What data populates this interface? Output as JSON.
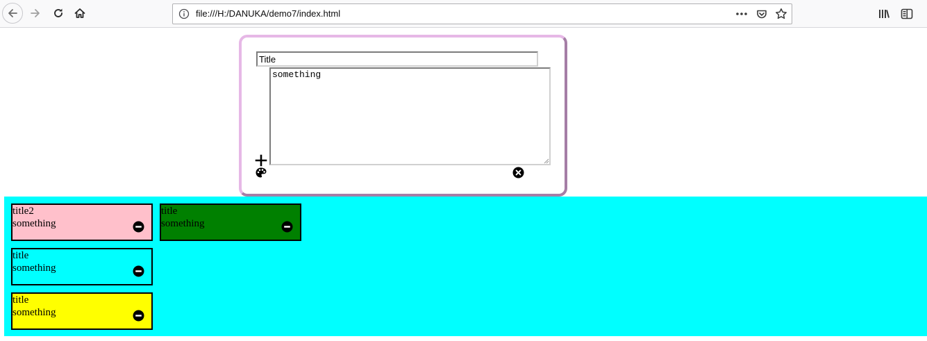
{
  "browser": {
    "url": "file:///H:/DANUKA/demo7/index.html"
  },
  "editor": {
    "title_value": "Title",
    "body_value": "something",
    "border_color": "#e6b8e6"
  },
  "board": {
    "background": "#00ffff",
    "notes": [
      {
        "title": "title2",
        "body": "something",
        "color": "#ffc0cb"
      },
      {
        "title": "title",
        "body": "something",
        "color": "#008000"
      },
      {
        "title": "title",
        "body": "something",
        "color": "#00ffff"
      },
      {
        "title": "title",
        "body": "something",
        "color": "#ffff00"
      }
    ]
  },
  "icons": {
    "back": "arrow-left-icon",
    "forward": "arrow-right-icon",
    "reload": "reload-icon",
    "home": "home-icon",
    "info": "info-icon",
    "page_actions": "ellipsis-icon",
    "pocket": "pocket-icon",
    "bookmark": "star-icon",
    "library": "library-icon",
    "sidebar": "sidebar-icon",
    "add": "plus-icon",
    "palette": "palette-icon",
    "close": "close-circle-icon",
    "remove": "minus-circle-icon"
  }
}
